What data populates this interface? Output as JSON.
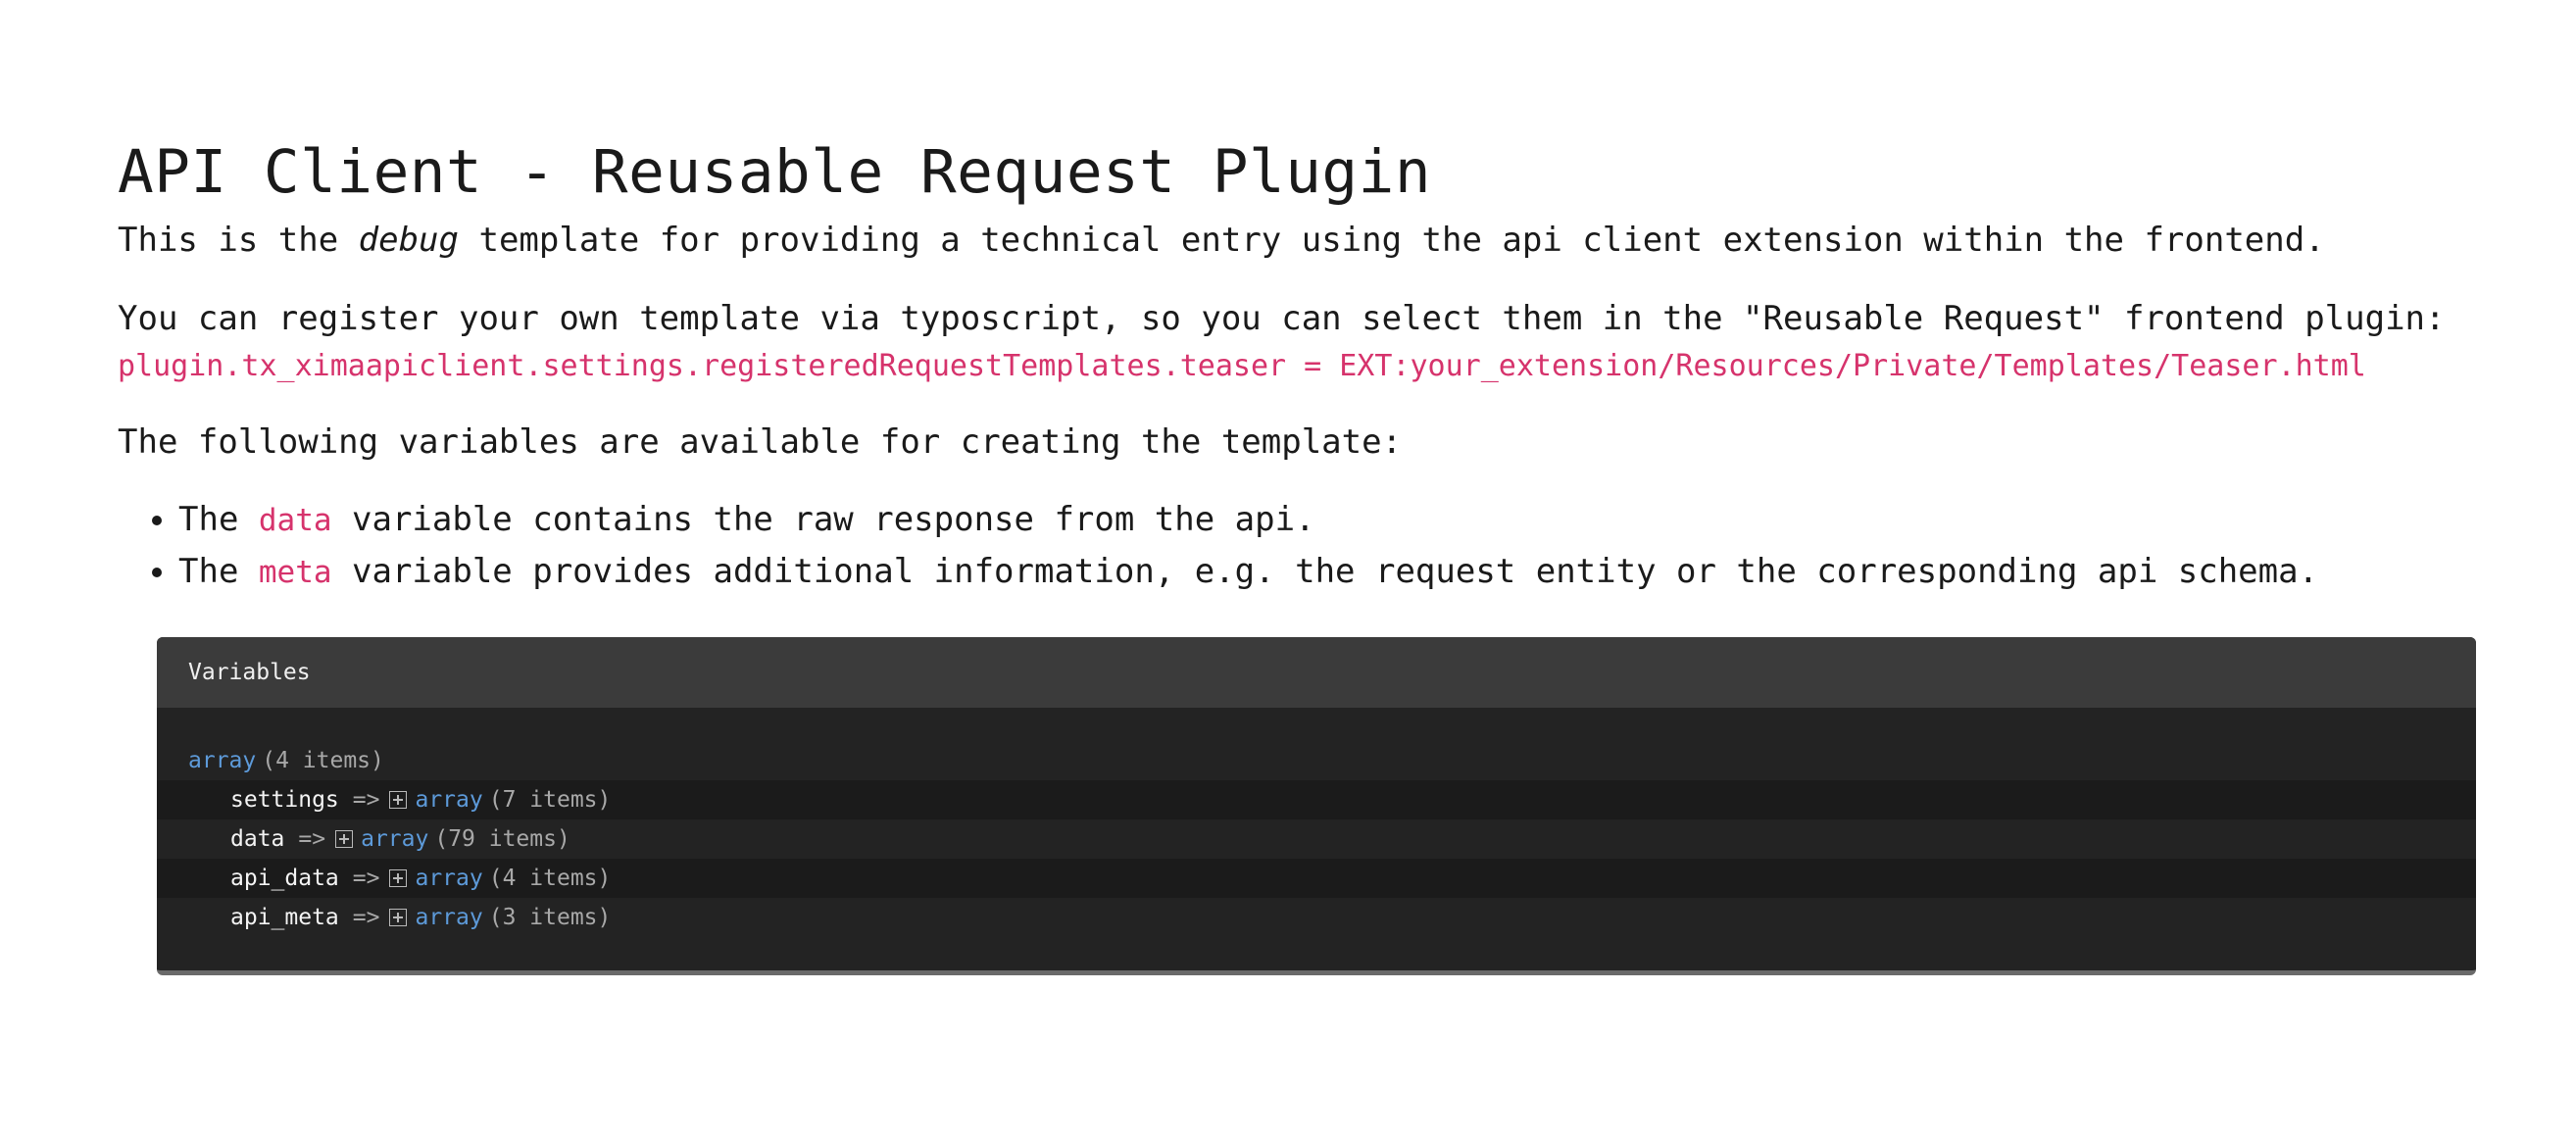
{
  "title": "API Client - Reusable Request Plugin",
  "intro": {
    "before": "This is the ",
    "emphasis": "debug",
    "after": " template for providing a technical entry using the api client extension within the frontend."
  },
  "register_text": "You can register your own template via typoscript, so you can select them in the \"Reusable Request\" frontend plugin:",
  "typoscript_code": "plugin.tx_ximaapiclient.settings.registeredRequestTemplates.teaser = EXT:your_extension/Resources/Private/Templates/Teaser.html",
  "variables_intro": "The following variables are available for creating the template:",
  "bullets": [
    {
      "before": "The ",
      "code": "data",
      "after": " variable contains the raw response from the api."
    },
    {
      "before": "The ",
      "code": "meta",
      "after": " variable provides additional information, e.g. the request entity or the corresponding api schema."
    }
  ],
  "debug": {
    "header": "Variables",
    "root": {
      "type": "array",
      "count": "(4 items)"
    },
    "arrow": "=>",
    "items": [
      {
        "key": "settings",
        "type": "array",
        "count": "(7 items)"
      },
      {
        "key": "data",
        "type": "array",
        "count": "(79 items)"
      },
      {
        "key": "api_data",
        "type": "array",
        "count": "(4 items)"
      },
      {
        "key": "api_meta",
        "type": "array",
        "count": "(3 items)"
      }
    ]
  },
  "colors": {
    "code_pink": "#d6336c",
    "debug_bg": "#232323",
    "debug_header_bg": "#3b3b3b",
    "type_blue": "#5d9ad9"
  }
}
